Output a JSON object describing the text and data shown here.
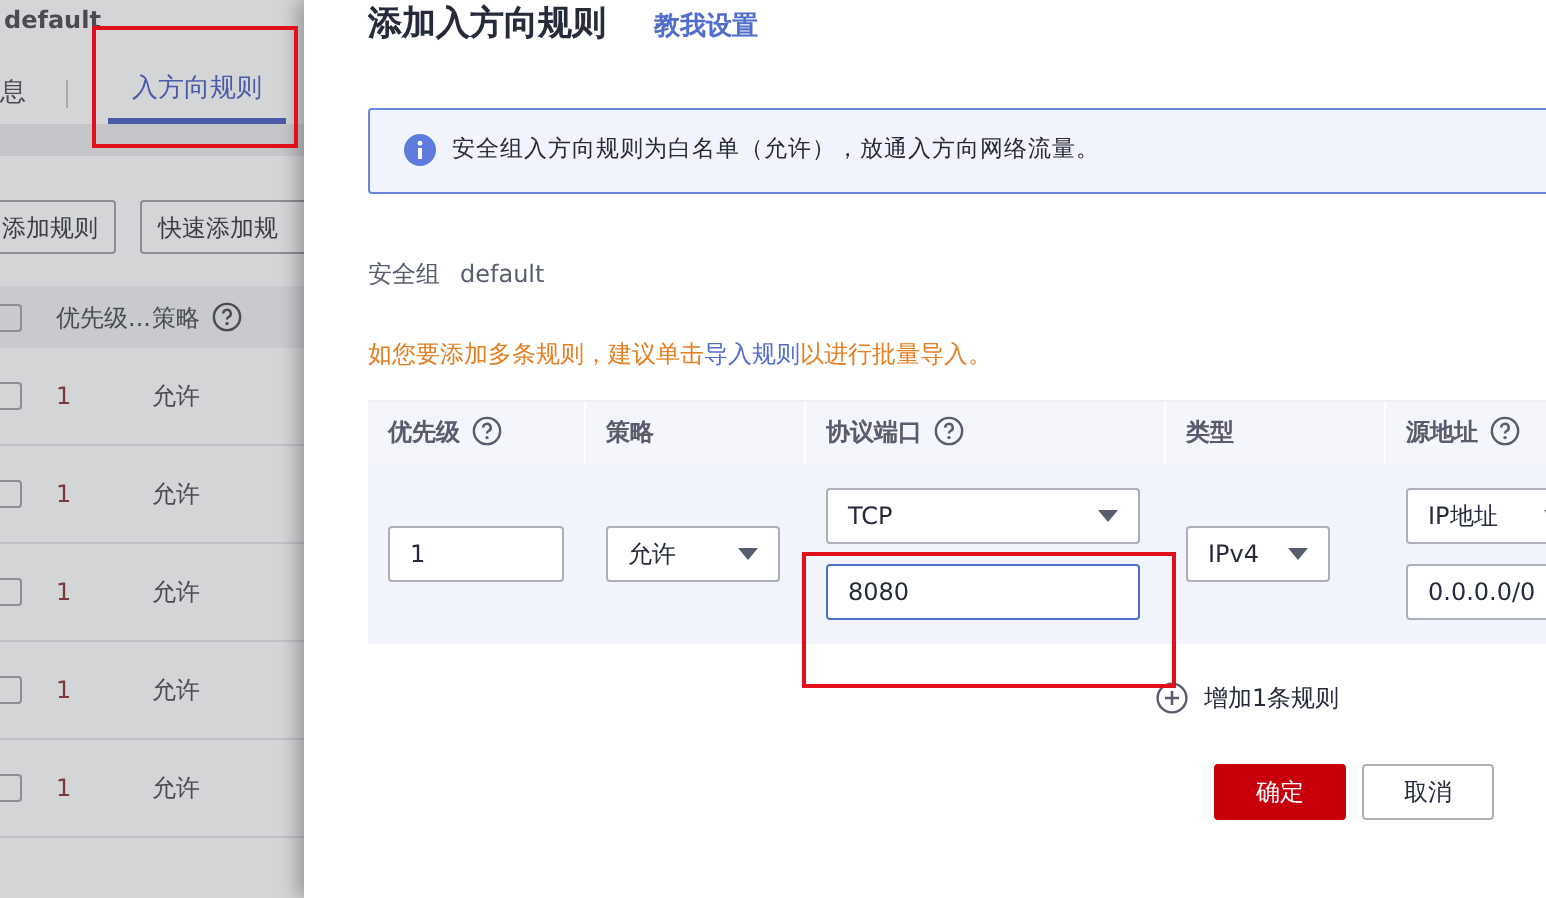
{
  "background": {
    "title": "default",
    "tabs": [
      {
        "label": "息",
        "selected": false,
        "highlighted": false
      },
      {
        "label": "入方向规则",
        "selected": true,
        "highlighted": true
      }
    ],
    "buttons": [
      "添加规则",
      "快速添加规"
    ],
    "table": {
      "header_checked": false,
      "columns": [
        {
          "label": "优先级...",
          "help": false
        },
        {
          "label": "策略",
          "help": true
        }
      ],
      "rows": [
        {
          "checked": false,
          "priority": "1",
          "action": "允许"
        },
        {
          "checked": false,
          "priority": "1",
          "action": "允许"
        },
        {
          "checked": false,
          "priority": "1",
          "action": "允许"
        },
        {
          "checked": false,
          "priority": "1",
          "action": "允许"
        },
        {
          "checked": false,
          "priority": "1",
          "action": "允许"
        }
      ]
    }
  },
  "dialog": {
    "title": "添加入方向规则",
    "help_link": "教我设置",
    "notice": "安全组入方向规则为白名单（允许），放通入方向网络流量。",
    "security_group": {
      "label": "安全组",
      "value": "default"
    },
    "hint": {
      "before": "如您要添加多条规则，建议单击",
      "link": "导入规则",
      "after": "以进行批量导入。"
    },
    "columns": [
      {
        "label": "优先级",
        "help": true
      },
      {
        "label": "策略",
        "help": false
      },
      {
        "label": "协议端口",
        "help": true
      },
      {
        "label": "类型",
        "help": false
      },
      {
        "label": "源地址",
        "help": true
      }
    ],
    "row": {
      "cells": [
        [
          {
            "kind": "input",
            "value": "1",
            "focused": false,
            "highlighted": false
          }
        ],
        [
          {
            "kind": "select",
            "value": "允许"
          }
        ],
        [
          {
            "kind": "select",
            "value": "TCP"
          },
          {
            "kind": "input",
            "value": "8080",
            "focused": true,
            "highlighted": true
          }
        ],
        [
          {
            "kind": "select",
            "value": "IPv4"
          }
        ],
        [
          {
            "kind": "select",
            "value": "IP地址"
          },
          {
            "kind": "input",
            "value": "0.0.0.0/0",
            "focused": false,
            "highlighted": false
          }
        ]
      ]
    },
    "add_rule": "增加1条规则",
    "buttons": [
      {
        "label": "确定",
        "kind": "primary"
      },
      {
        "label": "取消",
        "kind": "secondary"
      }
    ]
  }
}
